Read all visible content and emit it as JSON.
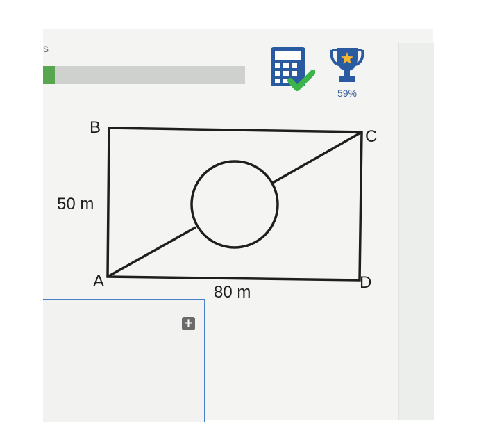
{
  "header": {
    "partial_text": "s",
    "progress_fraction": 0.06
  },
  "toolbar": {
    "calculator_icon": "calculator-check-icon",
    "trophy_icon": "trophy-star-icon",
    "score_percent": "59%"
  },
  "diagram": {
    "vertex_labels": {
      "A": "A",
      "B": "B",
      "C": "C",
      "D": "D"
    },
    "side_label": "50 m",
    "bottom_label": "80 m"
  },
  "answer": {
    "add_icon": "plus-icon"
  },
  "colors": {
    "accent_blue": "#2a5aa0",
    "check_green": "#3bb54a",
    "star_gold": "#f2b632",
    "frame_line": "#1e1e1e"
  }
}
